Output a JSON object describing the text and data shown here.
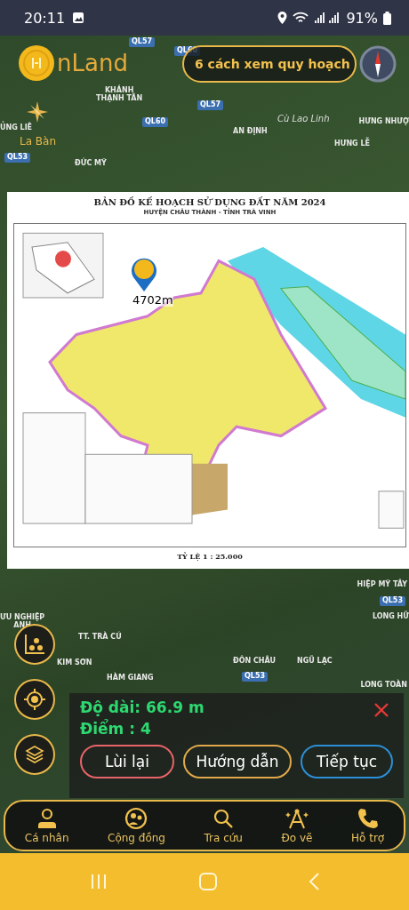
{
  "status_bar": {
    "time": "20:11",
    "battery": "91%"
  },
  "brand": {
    "name": "nLand"
  },
  "guide_pill": {
    "label": "6 cách xem quy hoạch"
  },
  "compass_label": "La Bàn",
  "map_labels": [
    {
      "text": "QL57",
      "kind": "road"
    },
    {
      "text": "QL60",
      "kind": "road"
    },
    {
      "text": "KHÁNH\nTHẠNH TÂN",
      "kind": "place"
    },
    {
      "text": "QL57",
      "kind": "road"
    },
    {
      "text": "QL60",
      "kind": "road"
    },
    {
      "text": "Cù Lao Linh",
      "kind": "island"
    },
    {
      "text": "HƯNG NHƯỢ",
      "kind": "place"
    },
    {
      "text": "ỦNG LIÊ",
      "kind": "place"
    },
    {
      "text": "AN ĐỊNH",
      "kind": "place"
    },
    {
      "text": "HƯNG LỄ",
      "kind": "place"
    },
    {
      "text": "QL53",
      "kind": "road"
    },
    {
      "text": "ĐỨC MỸ",
      "kind": "place"
    },
    {
      "text": "HIỆP MỸ TÂY",
      "kind": "place"
    },
    {
      "text": "QL53",
      "kind": "road"
    },
    {
      "text": "ƯU NGHIỆP\nANH",
      "kind": "place"
    },
    {
      "text": "LONG HỮ",
      "kind": "place"
    },
    {
      "text": "TT. TRÀ CÚ",
      "kind": "place"
    },
    {
      "text": "KIM SƠN",
      "kind": "place"
    },
    {
      "text": "ĐÔN CHÂU",
      "kind": "place"
    },
    {
      "text": "NGŨ LẠC",
      "kind": "place"
    },
    {
      "text": "HÀM GIANG",
      "kind": "place"
    },
    {
      "text": "QL53",
      "kind": "road"
    },
    {
      "text": "LONG TOÀN",
      "kind": "place"
    }
  ],
  "plan_sheet": {
    "title": "BẢN ĐỒ KẾ HOẠCH SỬ DỤNG ĐẤT NĂM 2024",
    "subtitle": "HUYỆN CHÂU THÀNH - TỈNH TRÀ VINH",
    "scale": "TỶ LỆ 1 : 25.000",
    "pin_label": "4702m"
  },
  "side_buttons": [
    {
      "kind": "chart"
    },
    {
      "kind": "locate"
    },
    {
      "kind": "layers"
    }
  ],
  "measure_panel": {
    "length": "Độ dài: 66.9 m",
    "points": "Điểm  : 4",
    "buttons": [
      {
        "label": "Lùi lại",
        "color": "#e8636a"
      },
      {
        "label": "Hướng dẫn",
        "color": "#e0a94a"
      },
      {
        "label": "Tiếp tục",
        "color": "#2b8fd8"
      }
    ]
  },
  "bottom_nav": [
    {
      "label": "Cá nhân"
    },
    {
      "label": "Cộng đồng"
    },
    {
      "label": "Tra cứu"
    },
    {
      "label": "Đo vẽ"
    },
    {
      "label": "Hỗ trợ"
    }
  ]
}
